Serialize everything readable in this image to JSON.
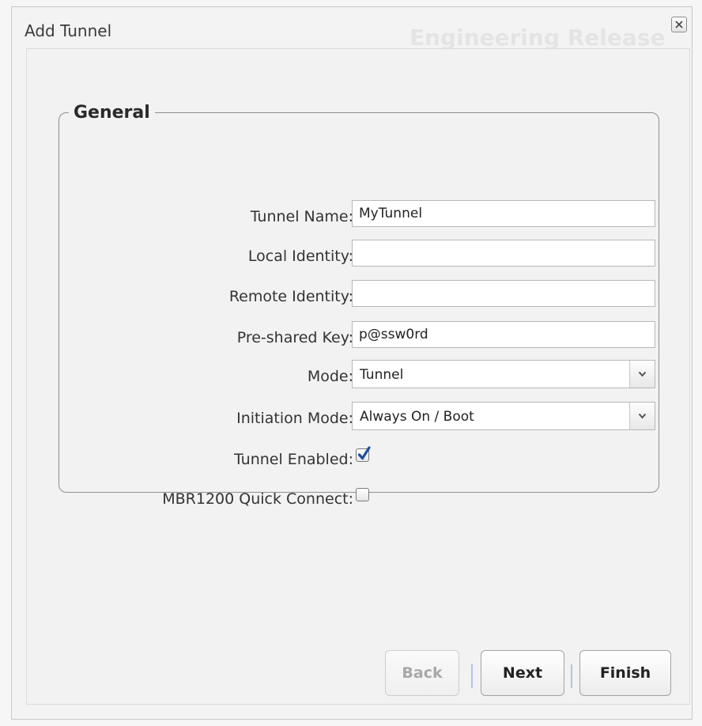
{
  "dialog": {
    "title": "Add Tunnel",
    "background_watermark": "Engineering Release",
    "close_icon": "close-icon"
  },
  "general": {
    "legend": "General",
    "fields": {
      "tunnel_name": {
        "label": "Tunnel Name:",
        "value": "MyTunnel"
      },
      "local_identity": {
        "label": "Local Identity:",
        "value": ""
      },
      "remote_identity": {
        "label": "Remote Identity:",
        "value": ""
      },
      "pre_shared_key": {
        "label": "Pre-shared Key:",
        "value": "p@ssw0rd"
      },
      "mode": {
        "label": "Mode:",
        "value": "Tunnel"
      },
      "initiation_mode": {
        "label": "Initiation Mode:",
        "value": "Always On / Boot"
      },
      "tunnel_enabled": {
        "label": "Tunnel Enabled:",
        "checked": true
      },
      "quick_connect": {
        "label": "MBR1200 Quick Connect:",
        "checked": false
      }
    }
  },
  "buttons": {
    "back": {
      "label": "Back",
      "enabled": false
    },
    "next": {
      "label": "Next",
      "enabled": true
    },
    "finish": {
      "label": "Finish",
      "enabled": true
    }
  },
  "colors": {
    "checkbox_check": "#1f4f9e",
    "button_separator": "#a9c8e8"
  }
}
